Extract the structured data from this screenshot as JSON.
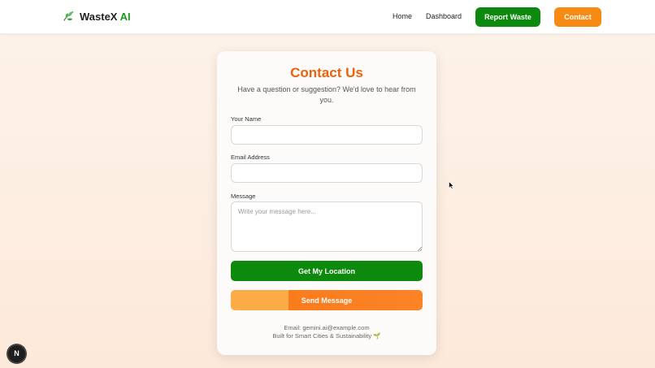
{
  "navbar": {
    "brand_main": "WasteX",
    "brand_accent": "AI",
    "brand_icon": "leaf-icon",
    "links": {
      "home": "Home",
      "dashboard": "Dashboard"
    },
    "report_button": "Report Waste",
    "contact_button": "Contact"
  },
  "card": {
    "title": "Contact Us",
    "subtitle": "Have a question or suggestion? We'd love to hear from you.",
    "fields": {
      "name_label": "Your Name",
      "name_value": "",
      "email_label": "Email Address",
      "email_value": "",
      "message_label": "Message",
      "message_placeholder": "Write your message here..."
    },
    "location_button": "Get My Location",
    "send_button": "Send Message",
    "footer_email": "Email: gemini.ai@example.com",
    "footer_built": "Built for Smart Cities & Sustainability 🌱"
  },
  "dev_badge": "N",
  "colors": {
    "green": "#0d8a0d",
    "orange": "#f78a14",
    "title_orange": "#e8620f",
    "send_progress_light": "#fcab47",
    "send_progress_dark": "#f97c1c"
  },
  "send_button_progress": 0.3
}
